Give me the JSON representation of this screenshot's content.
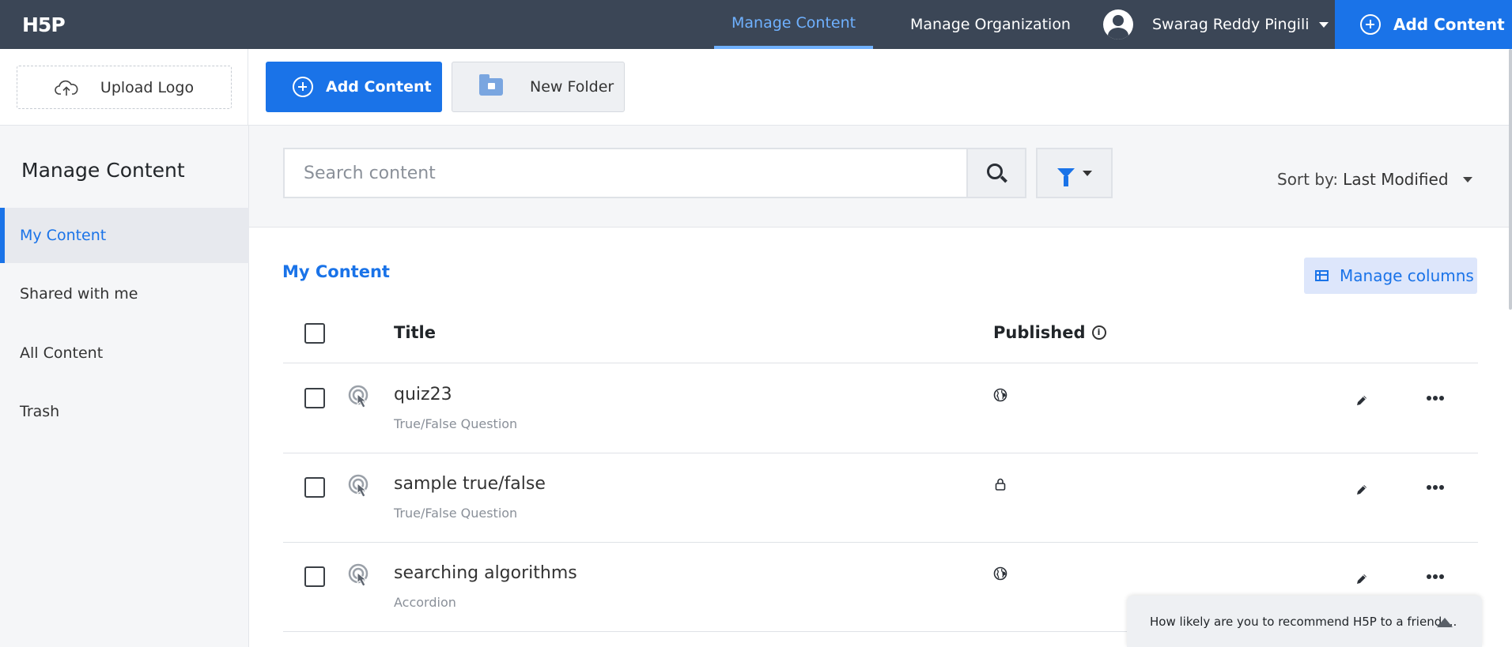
{
  "nav": {
    "logo": "H5P",
    "links": [
      "Manage Content",
      "Manage Organization"
    ],
    "user_name": "Swarag Reddy Pingili",
    "add_content": "Add Content"
  },
  "toolbar": {
    "upload_logo": "Upload Logo",
    "add_content": "Add Content",
    "new_folder": "New Folder"
  },
  "sidebar": {
    "title": "Manage Content",
    "items": [
      "My Content",
      "Shared with me",
      "All Content",
      "Trash"
    ],
    "active": "My Content"
  },
  "search": {
    "placeholder": "Search content",
    "sort_label": "Sort by:",
    "sort_value": "Last Modified"
  },
  "content": {
    "title": "My Content",
    "manage_columns": "Manage columns",
    "columns": {
      "title": "Title",
      "published": "Published"
    },
    "rows": [
      {
        "title": "quiz23",
        "type": "True/False Question",
        "published": "public"
      },
      {
        "title": "sample true/false",
        "type": "True/False Question",
        "published": "private"
      },
      {
        "title": "searching algorithms",
        "type": "Accordion",
        "published": "public"
      }
    ]
  },
  "survey": {
    "text": "How likely are you to recommend H5P to a friend ..."
  },
  "colors": {
    "topbar": "#3b4656",
    "accent": "#1a73e8",
    "active_link": "#6fb1ff"
  }
}
